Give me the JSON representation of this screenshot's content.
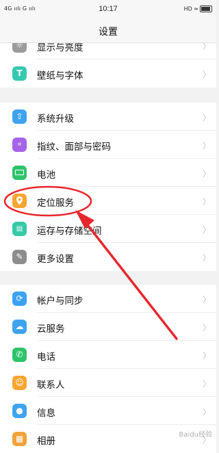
{
  "status": {
    "left": "4G ıılı G ıılı",
    "time": "10:17",
    "right": "HD ≈"
  },
  "title": "设置",
  "groups": [
    {
      "items": [
        {
          "label": "显示与亮度",
          "icon": "sun-icon",
          "color": "#9b9b9b"
        },
        {
          "label": "壁纸与字体",
          "icon": "text-icon",
          "color": "#35c9b0"
        }
      ]
    },
    {
      "items": [
        {
          "label": "系统升级",
          "icon": "upgrade-icon",
          "color": "#3fa3f0"
        },
        {
          "label": "指纹、面部与密码",
          "icon": "fingerprint-icon",
          "color": "#a564e8"
        },
        {
          "label": "电池",
          "icon": "battery-icon",
          "color": "#2ec46b"
        },
        {
          "label": "定位服务",
          "icon": "location-icon",
          "color": "#f8a531"
        },
        {
          "label": "运存与存储空间",
          "icon": "storage-icon",
          "color": "#36c9a8"
        },
        {
          "label": "更多设置",
          "icon": "wrench-icon",
          "color": "#8d8d8d"
        }
      ]
    },
    {
      "items": [
        {
          "label": "帐户与同步",
          "icon": "account-icon",
          "color": "#3ca2f2"
        },
        {
          "label": "云服务",
          "icon": "cloud-icon",
          "color": "#3fa3f0"
        },
        {
          "label": "电话",
          "icon": "phone-icon",
          "color": "#2ec46b"
        },
        {
          "label": "联系人",
          "icon": "contacts-icon",
          "color": "#f8a531"
        },
        {
          "label": "信息",
          "icon": "message-icon",
          "color": "#3fa3f0"
        },
        {
          "label": "相册",
          "icon": "album-icon",
          "color": "#f0a23a"
        }
      ]
    }
  ],
  "watermark": "Baidu经验"
}
